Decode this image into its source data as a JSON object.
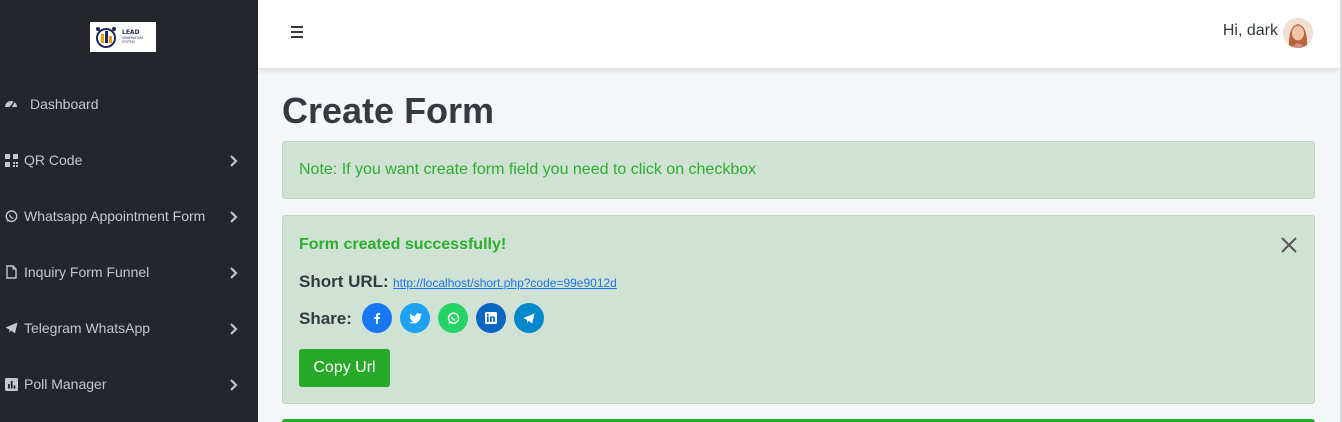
{
  "brand": {
    "line1": "LEAD",
    "line2": "GENERATION",
    "line3": "SYSTEM"
  },
  "sidebar": {
    "items": [
      {
        "label": "Dashboard",
        "icon": "dashboard-icon",
        "has_submenu": false
      },
      {
        "label": "QR Code",
        "icon": "qr-code-icon",
        "has_submenu": true
      },
      {
        "label": "Whatsapp Appointment Form",
        "icon": "whatsapp-icon",
        "has_submenu": true
      },
      {
        "label": "Inquiry Form Funnel",
        "icon": "file-icon",
        "has_submenu": true
      },
      {
        "label": "Telegram WhatsApp",
        "icon": "telegram-icon",
        "has_submenu": true
      },
      {
        "label": "Poll Manager",
        "icon": "poll-icon",
        "has_submenu": true
      }
    ]
  },
  "header": {
    "greeting": "Hi, dark"
  },
  "main": {
    "title": "Create Form",
    "note": "Note: If you want create form field you need to click on checkbox",
    "success": {
      "title": "Form created successfully!",
      "short_url_label": "Short URL:",
      "short_url": "http://localhost/short.php?code=99e9012d",
      "share_label": "Share:",
      "share_buttons": [
        {
          "name": "facebook",
          "icon": "facebook-icon",
          "color": "#1877f2"
        },
        {
          "name": "twitter",
          "icon": "twitter-icon",
          "color": "#1da1f2"
        },
        {
          "name": "whatsapp",
          "icon": "whatsapp-icon",
          "color": "#25d366"
        },
        {
          "name": "linkedin",
          "icon": "linkedin-icon",
          "color": "#0a66c2"
        },
        {
          "name": "telegram",
          "icon": "telegram-icon",
          "color": "#0088cc"
        }
      ],
      "copy_label": "Copy Url"
    }
  },
  "colors": {
    "sidebar_bg": "#23272b",
    "success_text": "#2eae2e",
    "alert_bg": "#d0e2d4",
    "button_green": "#28a828"
  }
}
